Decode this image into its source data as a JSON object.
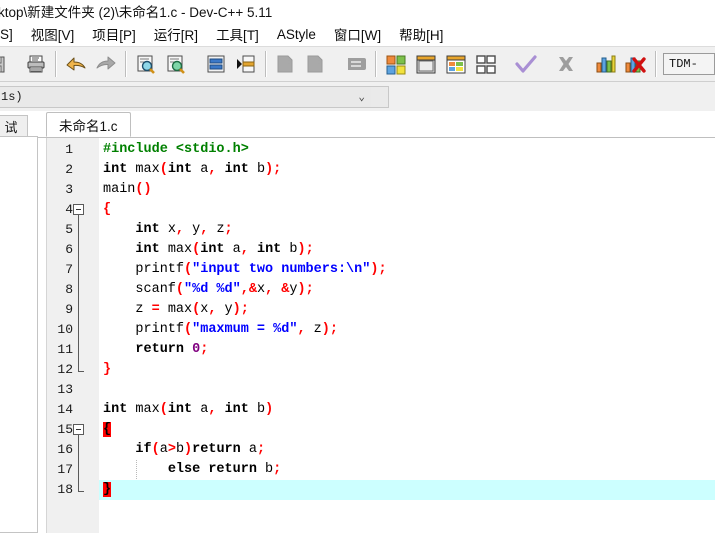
{
  "window": {
    "title": "ktop\\新建文件夹 (2)\\未命名1.c - Dev-C++ 5.11"
  },
  "menubar": {
    "items": [
      {
        "label": "S]",
        "name": "menu-search-partial"
      },
      {
        "label": "视图[V]",
        "name": "menu-view"
      },
      {
        "label": "项目[P]",
        "name": "menu-project"
      },
      {
        "label": "运行[R]",
        "name": "menu-run"
      },
      {
        "label": "工具[T]",
        "name": "menu-tools"
      },
      {
        "label": "AStyle",
        "name": "menu-astyle"
      },
      {
        "label": "窗口[W]",
        "name": "menu-window"
      },
      {
        "label": "帮助[H]",
        "name": "menu-help"
      }
    ]
  },
  "toolbar": {
    "buttons": [
      {
        "icon": "save-icon",
        "name": "toolbar-save",
        "enabled": true
      },
      {
        "icon": "print-icon",
        "name": "toolbar-print",
        "enabled": true
      },
      {
        "icon": "undo-icon",
        "name": "toolbar-undo",
        "enabled": true
      },
      {
        "icon": "redo-icon",
        "name": "toolbar-redo",
        "enabled": false
      },
      {
        "icon": "find-icon",
        "name": "toolbar-find",
        "enabled": true
      },
      {
        "icon": "replace-icon",
        "name": "toolbar-replace",
        "enabled": true
      },
      {
        "icon": "goto-line-icon",
        "name": "toolbar-goto-line",
        "enabled": true
      },
      {
        "icon": "toggle-bookmark-icon",
        "name": "toolbar-toggle-bookmark",
        "enabled": true
      },
      {
        "icon": "new-project-icon",
        "name": "toolbar-new-project",
        "enabled": false
      },
      {
        "icon": "open-project-icon",
        "name": "toolbar-open-project",
        "enabled": false
      },
      {
        "icon": "close-project-icon",
        "name": "toolbar-close-project",
        "enabled": false
      },
      {
        "icon": "compile-icon",
        "name": "toolbar-compile",
        "enabled": true,
        "highlighted": true
      },
      {
        "icon": "run-icon",
        "name": "toolbar-run",
        "enabled": true
      },
      {
        "icon": "compile-run-icon",
        "name": "toolbar-compile-run",
        "enabled": true
      },
      {
        "icon": "rebuild-all-icon",
        "name": "toolbar-rebuild-all",
        "enabled": true
      },
      {
        "icon": "syntax-check-icon",
        "name": "toolbar-syntax-check",
        "enabled": true
      },
      {
        "icon": "stop-execution-icon",
        "name": "toolbar-stop-execution",
        "enabled": false
      },
      {
        "icon": "profile-icon",
        "name": "toolbar-profile",
        "enabled": true
      },
      {
        "icon": "delete-profile-icon",
        "name": "toolbar-delete-profile",
        "enabled": true
      }
    ],
    "annotation_color": "#e81b1b"
  },
  "compiler_combo": {
    "value": "1s)",
    "chevron": "⌄"
  },
  "left_panel": {
    "tab_label": "试"
  },
  "editor": {
    "tab_label": "未命名1.c",
    "current_line": 18,
    "filename": "未命名1.c",
    "lines": [
      {
        "n": 1,
        "indent": 0,
        "tokens": [
          {
            "t": "#include <stdio.h>",
            "c": "t-pre"
          }
        ]
      },
      {
        "n": 2,
        "indent": 0,
        "tokens": [
          {
            "t": "int",
            "c": "t-kw"
          },
          {
            "t": " max",
            "c": "t-id"
          },
          {
            "t": "(",
            "c": "t-punc"
          },
          {
            "t": "int",
            "c": "t-kw"
          },
          {
            "t": " a",
            "c": "t-id"
          },
          {
            "t": ",",
            "c": "t-punc"
          },
          {
            "t": " ",
            "c": "t-id"
          },
          {
            "t": "int",
            "c": "t-kw"
          },
          {
            "t": " b",
            "c": "t-id"
          },
          {
            "t": ");",
            "c": "t-punc"
          }
        ]
      },
      {
        "n": 3,
        "indent": 0,
        "tokens": [
          {
            "t": "main",
            "c": "t-id"
          },
          {
            "t": "()",
            "c": "t-punc"
          }
        ]
      },
      {
        "n": 4,
        "indent": 0,
        "fold": "start",
        "tokens": [
          {
            "t": "{",
            "c": "t-punc"
          }
        ]
      },
      {
        "n": 5,
        "indent": 1,
        "tokens": [
          {
            "t": "int",
            "c": "t-kw"
          },
          {
            "t": " x",
            "c": "t-id"
          },
          {
            "t": ",",
            "c": "t-punc"
          },
          {
            "t": " y",
            "c": "t-id"
          },
          {
            "t": ",",
            "c": "t-punc"
          },
          {
            "t": " z",
            "c": "t-id"
          },
          {
            "t": ";",
            "c": "t-punc"
          }
        ]
      },
      {
        "n": 6,
        "indent": 1,
        "tokens": [
          {
            "t": "int",
            "c": "t-kw"
          },
          {
            "t": " max",
            "c": "t-id"
          },
          {
            "t": "(",
            "c": "t-punc"
          },
          {
            "t": "int",
            "c": "t-kw"
          },
          {
            "t": " a",
            "c": "t-id"
          },
          {
            "t": ",",
            "c": "t-punc"
          },
          {
            "t": " ",
            "c": "t-id"
          },
          {
            "t": "int",
            "c": "t-kw"
          },
          {
            "t": " b",
            "c": "t-id"
          },
          {
            "t": ");",
            "c": "t-punc"
          }
        ]
      },
      {
        "n": 7,
        "indent": 1,
        "tokens": [
          {
            "t": "printf",
            "c": "t-id"
          },
          {
            "t": "(",
            "c": "t-punc"
          },
          {
            "t": "\"input two numbers:\\n\"",
            "c": "t-str"
          },
          {
            "t": ");",
            "c": "t-punc"
          }
        ]
      },
      {
        "n": 8,
        "indent": 1,
        "tokens": [
          {
            "t": "scanf",
            "c": "t-id"
          },
          {
            "t": "(",
            "c": "t-punc"
          },
          {
            "t": "\"%d %d\"",
            "c": "t-str"
          },
          {
            "t": ",",
            "c": "t-punc"
          },
          {
            "t": "&",
            "c": "t-op"
          },
          {
            "t": "x",
            "c": "t-id"
          },
          {
            "t": ",",
            "c": "t-punc"
          },
          {
            "t": " ",
            "c": "t-id"
          },
          {
            "t": "&",
            "c": "t-op"
          },
          {
            "t": "y",
            "c": "t-id"
          },
          {
            "t": ");",
            "c": "t-punc"
          }
        ]
      },
      {
        "n": 9,
        "indent": 1,
        "tokens": [
          {
            "t": "z ",
            "c": "t-id"
          },
          {
            "t": "=",
            "c": "t-op"
          },
          {
            "t": " max",
            "c": "t-id"
          },
          {
            "t": "(",
            "c": "t-punc"
          },
          {
            "t": "x",
            "c": "t-id"
          },
          {
            "t": ",",
            "c": "t-punc"
          },
          {
            "t": " y",
            "c": "t-id"
          },
          {
            "t": ");",
            "c": "t-punc"
          }
        ]
      },
      {
        "n": 10,
        "indent": 1,
        "tokens": [
          {
            "t": "printf",
            "c": "t-id"
          },
          {
            "t": "(",
            "c": "t-punc"
          },
          {
            "t": "\"maxmum = %d\"",
            "c": "t-str"
          },
          {
            "t": ",",
            "c": "t-punc"
          },
          {
            "t": " z",
            "c": "t-id"
          },
          {
            "t": ");",
            "c": "t-punc"
          }
        ]
      },
      {
        "n": 11,
        "indent": 1,
        "tokens": [
          {
            "t": "return",
            "c": "t-kw"
          },
          {
            "t": " ",
            "c": "t-id"
          },
          {
            "t": "0",
            "c": "t-num"
          },
          {
            "t": ";",
            "c": "t-punc"
          }
        ]
      },
      {
        "n": 12,
        "indent": 0,
        "fold": "end",
        "tokens": [
          {
            "t": "}",
            "c": "t-punc"
          }
        ]
      },
      {
        "n": 13,
        "indent": 0,
        "tokens": []
      },
      {
        "n": 14,
        "indent": 0,
        "tokens": [
          {
            "t": "int",
            "c": "t-kw"
          },
          {
            "t": " max",
            "c": "t-id"
          },
          {
            "t": "(",
            "c": "t-punc"
          },
          {
            "t": "int",
            "c": "t-kw"
          },
          {
            "t": " a",
            "c": "t-id"
          },
          {
            "t": ",",
            "c": "t-punc"
          },
          {
            "t": " ",
            "c": "t-id"
          },
          {
            "t": "int",
            "c": "t-kw"
          },
          {
            "t": " b",
            "c": "t-id"
          },
          {
            "t": ")",
            "c": "t-punc"
          }
        ]
      },
      {
        "n": 15,
        "indent": 0,
        "fold": "start",
        "tokens": [
          {
            "t": "{",
            "c": "t-brace-hl"
          }
        ]
      },
      {
        "n": 16,
        "indent": 1,
        "tokens": [
          {
            "t": "if",
            "c": "t-kw"
          },
          {
            "t": "(",
            "c": "t-punc"
          },
          {
            "t": "a",
            "c": "t-id"
          },
          {
            "t": ">",
            "c": "t-op"
          },
          {
            "t": "b",
            "c": "t-id"
          },
          {
            "t": ")",
            "c": "t-punc"
          },
          {
            "t": "return",
            "c": "t-kw"
          },
          {
            "t": " a",
            "c": "t-id"
          },
          {
            "t": ";",
            "c": "t-punc"
          }
        ]
      },
      {
        "n": 17,
        "indent": 2,
        "guide": true,
        "tokens": [
          {
            "t": "else",
            "c": "t-kw"
          },
          {
            "t": " ",
            "c": "t-id"
          },
          {
            "t": "return",
            "c": "t-kw"
          },
          {
            "t": " b",
            "c": "t-id"
          },
          {
            "t": ";",
            "c": "t-punc"
          }
        ]
      },
      {
        "n": 18,
        "indent": 0,
        "fold": "end",
        "current": true,
        "tokens": [
          {
            "t": "}",
            "c": "t-brace-hl"
          }
        ]
      }
    ]
  },
  "compiler_select": {
    "value": "TDM-"
  }
}
